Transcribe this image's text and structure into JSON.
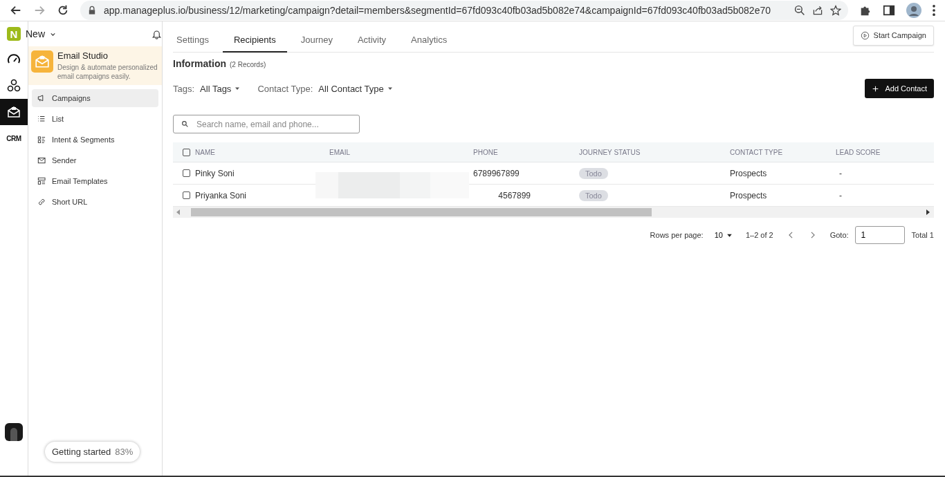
{
  "browser": {
    "url": "app.manageplus.io/business/12/marketing/campaign?detail=members&segmentId=67fd093c40fb03ad5b082e74&campaignId=67fd093c40fb03ad5b082e70"
  },
  "workspace": {
    "logo": "N",
    "name": "New"
  },
  "rail": [
    {
      "kind": "gauge",
      "selected": false
    },
    {
      "kind": "network",
      "selected": false
    },
    {
      "kind": "mail",
      "selected": true
    },
    {
      "kind": "crm",
      "label": "CRM",
      "selected": false
    }
  ],
  "studio": {
    "title": "Email Studio",
    "description": "Design & automate personalized email campaigns easily."
  },
  "menu": [
    {
      "kind": "megaphone",
      "label": "Campaigns",
      "selected": true
    },
    {
      "kind": "list",
      "label": "List",
      "selected": false
    },
    {
      "kind": "segments",
      "label": "Intent & Segments",
      "selected": false
    },
    {
      "kind": "sender",
      "label": "Sender",
      "selected": false
    },
    {
      "kind": "templates",
      "label": "Email Templates",
      "selected": false
    },
    {
      "kind": "link",
      "label": "Short URL",
      "selected": false
    }
  ],
  "getting_started": {
    "label": "Getting started",
    "percent": "83%"
  },
  "tabs": [
    {
      "label": "Settings",
      "selected": false
    },
    {
      "label": "Recipients",
      "selected": true
    },
    {
      "label": "Journey",
      "selected": false
    },
    {
      "label": "Activity",
      "selected": false
    },
    {
      "label": "Analytics",
      "selected": false
    }
  ],
  "start_button": "Start Campaign",
  "heading": {
    "title": "Information",
    "count": "(2 Records)"
  },
  "filters": [
    {
      "label": "Tags:",
      "value": "All Tags"
    },
    {
      "label": "Contact Type:",
      "value": "All Contact Type"
    }
  ],
  "add_button": "Add Contact",
  "search": {
    "placeholder": "Search name, email and phone..."
  },
  "table": {
    "columns": [
      "NAME",
      "EMAIL",
      "PHONE",
      "JOURNEY STATUS",
      "CONTACT TYPE",
      "LEAD SCORE"
    ],
    "header_checked": false,
    "rows": [
      {
        "checked": false,
        "name": "Pinky Soni",
        "phone": "6789967899",
        "status": "Todo",
        "contact_type": "Prospects",
        "lead_score": "-"
      },
      {
        "checked": false,
        "name": "Priyanka Soni",
        "phone": "4567899",
        "status": "Todo",
        "contact_type": "Prospects",
        "lead_score": "-"
      }
    ]
  },
  "pagination": {
    "rows_label": "Rows per page:",
    "rows_value": "10",
    "range": "1–2 of 2",
    "goto_label": "Goto:",
    "goto_value": "1",
    "total": "Total 1"
  }
}
